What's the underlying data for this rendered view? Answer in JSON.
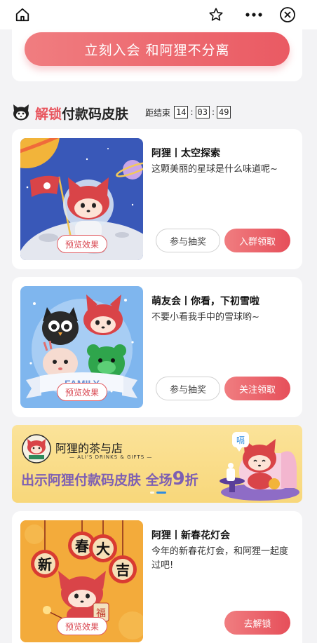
{
  "join": {
    "button_label": "立刻入会 和阿狸不分离"
  },
  "section": {
    "title_highlight": "解锁",
    "title_rest": "付款码皮肤",
    "countdown_label": "距结束",
    "hours": "14",
    "minutes": "03",
    "seconds": "49"
  },
  "cards": [
    {
      "title": "阿狸丨太空探索",
      "desc": "这颗美丽的星球是什么味道呢~",
      "preview_label": "预览效果",
      "secondary_label": "参与抽奖",
      "primary_label": "入群领取"
    },
    {
      "title": "萌友会丨你看，下初雪啦",
      "desc": "不要小看我手中的雪球哟~",
      "preview_label": "预览效果",
      "image_text": "FAMILY",
      "secondary_label": "参与抽奖",
      "primary_label": "关注领取"
    },
    {
      "title": "阿狸丨新春花灯会",
      "desc": "今年的新春花灯会，和阿狸一起度过吧!",
      "preview_label": "预览效果",
      "image_chars": [
        "新",
        "春",
        "大",
        "吉",
        "福"
      ],
      "primary_label": "去解锁"
    }
  ],
  "banner": {
    "brand": "阿狸的茶与店",
    "sub": "— ALI'S DRINKS & GIFTS —",
    "offer_text": "出示阿狸付款码皮肤 全场",
    "offer_num": "9",
    "offer_unit": "折",
    "bubble": "嗝"
  },
  "colors": {
    "accent": "#e8535c",
    "banner_bg": "#f8d77a",
    "offer_purple": "#7d5fb3"
  },
  "icons": {
    "home": "home-icon",
    "favorite": "star-icon",
    "more": "more-icon",
    "close": "close-icon"
  }
}
